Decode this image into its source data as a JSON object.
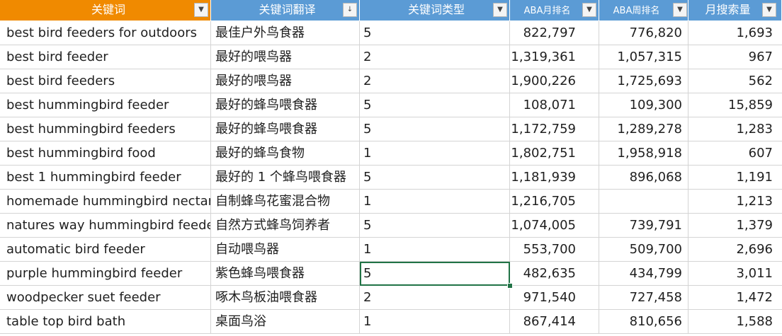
{
  "headers": {
    "keyword": "关键词",
    "translation": "关键词翻译",
    "type": "关键词类型",
    "aba_month": "ABA月排名",
    "aba_week": "ABA周排名",
    "monthly_search": "月搜索量"
  },
  "filter_icon": "▼",
  "sort_filter_icon": "↓",
  "colors": {
    "header_orange": "#f08a00",
    "header_blue": "#5b9bd5",
    "selection": "#217346"
  },
  "rows": [
    {
      "keyword": "best bird feeders for outdoors",
      "translation": "最佳户外鸟食器",
      "type": "5",
      "aba_month": "822,797",
      "aba_week": "776,820",
      "monthly_search": "1,693"
    },
    {
      "keyword": "best bird feeder",
      "translation": "最好的喂鸟器",
      "type": "2",
      "aba_month": "1,319,361",
      "aba_week": "1,057,315",
      "monthly_search": "967"
    },
    {
      "keyword": "best bird feeders",
      "translation": "最好的喂鸟器",
      "type": "2",
      "aba_month": "1,900,226",
      "aba_week": "1,725,693",
      "monthly_search": "562"
    },
    {
      "keyword": "best hummingbird feeder",
      "translation": "最好的蜂鸟喂食器",
      "type": "5",
      "aba_month": "108,071",
      "aba_week": "109,300",
      "monthly_search": "15,859"
    },
    {
      "keyword": "best hummingbird feeders",
      "translation": "最好的蜂鸟喂食器",
      "type": "5",
      "aba_month": "1,172,759",
      "aba_week": "1,289,278",
      "monthly_search": "1,283"
    },
    {
      "keyword": "best hummingbird food",
      "translation": "最好的蜂鸟食物",
      "type": "1",
      "aba_month": "1,802,751",
      "aba_week": "1,958,918",
      "monthly_search": "607"
    },
    {
      "keyword": "best 1 hummingbird feeder",
      "translation": "最好的 1 个蜂鸟喂食器",
      "type": "5",
      "aba_month": "1,181,939",
      "aba_week": "896,068",
      "monthly_search": "1,191"
    },
    {
      "keyword": "homemade hummingbird nectar mi",
      "translation": "自制蜂鸟花蜜混合物",
      "type": "1",
      "aba_month": "1,216,705",
      "aba_week": "",
      "monthly_search": "1,213"
    },
    {
      "keyword": "natures way hummingbird feeder",
      "translation": "自然方式蜂鸟饲养者",
      "type": "5",
      "aba_month": "1,074,005",
      "aba_week": "739,791",
      "monthly_search": "1,379"
    },
    {
      "keyword": "automatic bird feeder",
      "translation": "自动喂鸟器",
      "type": "1",
      "aba_month": "553,700",
      "aba_week": "509,700",
      "monthly_search": "2,696"
    },
    {
      "keyword": "purple hummingbird feeder",
      "translation": "紫色蜂鸟喂食器",
      "type": "5",
      "aba_month": "482,635",
      "aba_week": "434,799",
      "monthly_search": "3,011"
    },
    {
      "keyword": "woodpecker suet feeder",
      "translation": "啄木鸟板油喂食器",
      "type": "2",
      "aba_month": "971,540",
      "aba_week": "727,458",
      "monthly_search": "1,472"
    },
    {
      "keyword": "table top bird bath",
      "translation": "桌面鸟浴",
      "type": "1",
      "aba_month": "867,414",
      "aba_week": "810,656",
      "monthly_search": "1,588"
    }
  ]
}
